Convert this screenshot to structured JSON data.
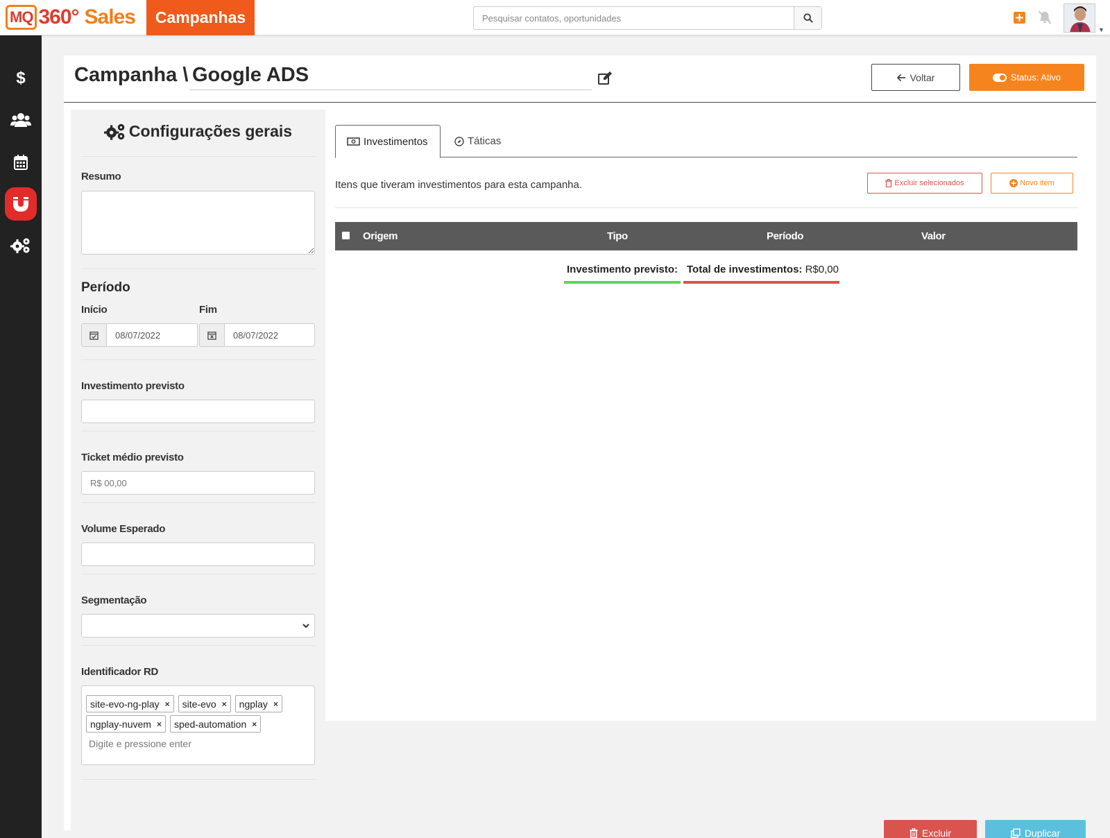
{
  "header": {
    "logo_mq": "MQ",
    "logo_360": "360°",
    "logo_sales": "Sales",
    "section": "Campanhas",
    "search_placeholder": "Pesquisar contatos, oportunidades",
    "icons": [
      "plus-square-icon",
      "bell-slash-icon",
      "avatar"
    ]
  },
  "sidebar": {
    "items": [
      {
        "icon": "dollar-icon",
        "active": false
      },
      {
        "icon": "users-icon",
        "active": false
      },
      {
        "icon": "calendar-icon",
        "active": false
      },
      {
        "icon": "magnet-icon",
        "active": true
      },
      {
        "icon": "gears-icon",
        "active": false
      }
    ]
  },
  "page": {
    "title_prefix": "Campanha \\",
    "campaign_name": "Google ADS",
    "back_label": "Voltar",
    "status_label": "Status: Ativo"
  },
  "settings": {
    "title": "Configurações gerais",
    "resumo_label": "Resumo",
    "resumo_value": "",
    "periodo_label": "Período",
    "inicio_label": "Início",
    "inicio_value": "08/07/2022",
    "fim_label": "Fim",
    "fim_value": "08/07/2022",
    "investimento_label": "Investimento previsto",
    "investimento_value": "",
    "ticket_label": "Ticket médio previsto",
    "ticket_placeholder": "R$ 00,00",
    "volume_label": "Volume Esperado",
    "volume_value": "",
    "segmentacao_label": "Segmentação",
    "segmentacao_value": "",
    "identificador_label": "Identificador RD",
    "tags": [
      "site-evo-ng-play",
      "site-evo",
      "ngplay",
      "ngplay-nuvem",
      "sped-automation"
    ],
    "tag_remove": "×",
    "tags_placeholder": "Digite e pressione enter"
  },
  "tabs": [
    {
      "label": "Investimentos",
      "active": true
    },
    {
      "label": "Táticas",
      "active": false
    }
  ],
  "investments": {
    "description": "Itens que tiveram investimentos para esta campanha.",
    "delete_selected_label": "Excluir selecionados",
    "new_item_label": "Novo item",
    "columns": [
      "Origem",
      "Tipo",
      "Período",
      "Valor"
    ],
    "rows": [],
    "investimento_previsto_label": "Investimento previsto:",
    "total_label": "Total de investimentos:",
    "total_value": "R$0,00"
  },
  "footer": {
    "delete_label": "Excluir",
    "duplicate_label": "Duplicar"
  },
  "colors": {
    "brand_orange": "#f5841f",
    "brand_red": "#e22b2b",
    "danger": "#d9534f",
    "info": "#5bc0de",
    "sidebar_bg": "#222222",
    "table_header": "#5a5a5a"
  }
}
